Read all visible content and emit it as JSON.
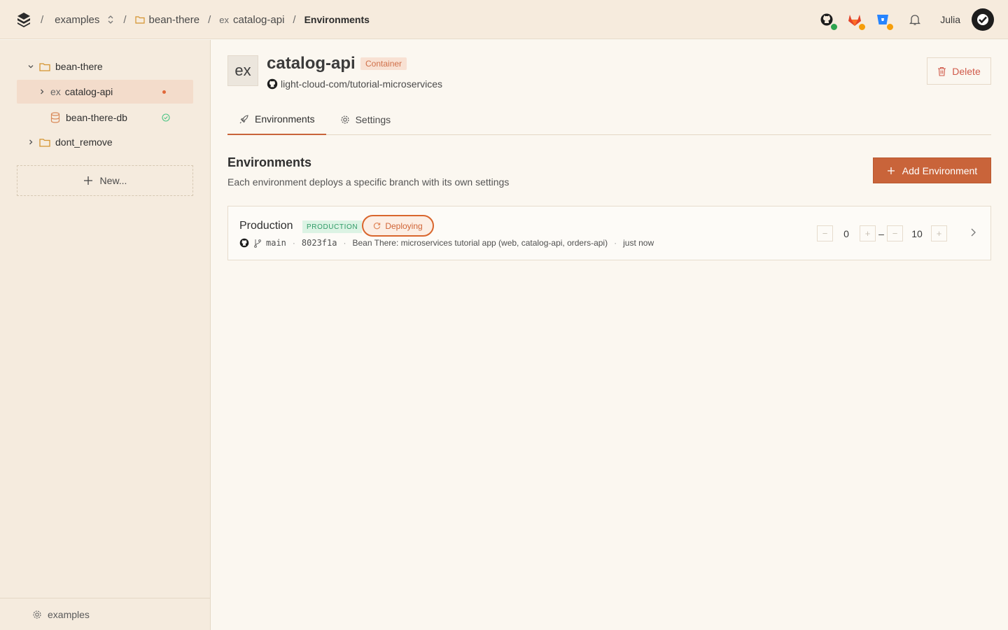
{
  "topbar": {
    "breadcrumb": {
      "workspace": "examples",
      "project": "bean-there",
      "service_prefix": "ex",
      "service": "catalog-api",
      "page": "Environments"
    },
    "icons": [
      "github-icon",
      "gitlab-icon",
      "bitbucket-icon",
      "bell-icon"
    ],
    "status_dot_colors": {
      "github": "#2ea44f",
      "gitlab": "#f59e0b",
      "bitbucket": "#f59e0b"
    },
    "user": {
      "name": "Julia"
    }
  },
  "sidebar": {
    "items": [
      {
        "label": "bean-there",
        "type": "folder",
        "expanded": true
      },
      {
        "label": "catalog-api",
        "prefix": "ex",
        "type": "service",
        "status": "deploying"
      },
      {
        "label": "bean-there-db",
        "type": "database",
        "status": "healthy"
      },
      {
        "label": "dont_remove",
        "type": "folder",
        "expanded": false
      }
    ],
    "new_label": "New...",
    "footer_label": "examples"
  },
  "service": {
    "icon_text": "ex",
    "title": "catalog-api",
    "type_badge": "Container",
    "repo": "light-cloud-com/tutorial-microservices",
    "delete_label": "Delete"
  },
  "tabs": [
    {
      "label": "Environments",
      "active": true
    },
    {
      "label": "Settings",
      "active": false
    }
  ],
  "environments_section": {
    "heading": "Environments",
    "subtitle": "Each environment deploys a specific branch with its own settings",
    "add_label": "Add Environment"
  },
  "environment": {
    "name": "Production",
    "badge": "PRODUCTION",
    "status": "Deploying",
    "branch": "main",
    "commit": "8023f1a",
    "commit_message": "Bean There: microservices tutorial app (web, catalog-api, orders-api)",
    "time": "just now",
    "min_instances": "0",
    "max_instances": "10",
    "range_sep": "–"
  },
  "colors": {
    "accent": "#c9643a",
    "danger": "#d05a4a",
    "success": "#2f9a66"
  }
}
